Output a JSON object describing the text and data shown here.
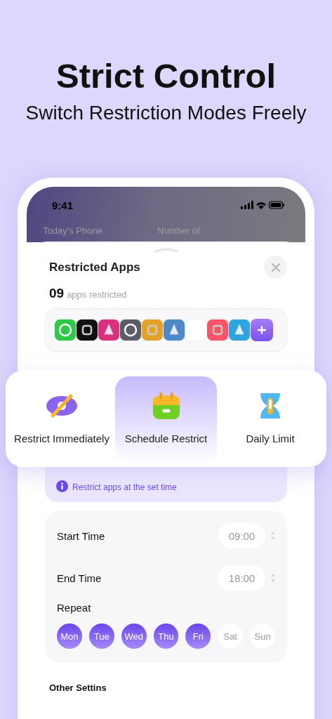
{
  "headline": {
    "title": "Strict Control",
    "subtitle": "Switch Restriction Modes Freely"
  },
  "status_bar": {
    "time": "9:41"
  },
  "background_stats": [
    "Today's Phone",
    "Number of"
  ],
  "sheet": {
    "title": "Restricted Apps",
    "count": "09",
    "count_label": "apps restricted",
    "apps": [
      {
        "color": "#2fc94a"
      },
      {
        "color": "#111111"
      },
      {
        "color": "#d9317e"
      },
      {
        "color": "#5a5d66"
      },
      {
        "color": "#e3a128"
      },
      {
        "color": "#4f88c9"
      },
      {
        "color": "#ffffff"
      },
      {
        "color": "#fe5468"
      },
      {
        "color": "#2ca5e0"
      }
    ],
    "modes": [
      {
        "label": "Restrict Immediately",
        "kind": "eye",
        "selected": false
      },
      {
        "label": "Schedule Restrict",
        "kind": "calendar",
        "selected": true
      },
      {
        "label": "Daily Limit",
        "kind": "hourglass",
        "selected": false
      }
    ],
    "info": "Restrict apps at the set time",
    "times": [
      {
        "label": "Start Time",
        "value": "09:00"
      },
      {
        "label": "End Time",
        "value": "18:00"
      }
    ],
    "repeat_label": "Repeat",
    "days": [
      {
        "label": "Mon",
        "selected": true
      },
      {
        "label": "Tue",
        "selected": true
      },
      {
        "label": "Wed",
        "selected": true
      },
      {
        "label": "Thu",
        "selected": true
      },
      {
        "label": "Fri",
        "selected": true
      },
      {
        "label": "Sat",
        "selected": false
      },
      {
        "label": "Sun",
        "selected": false
      }
    ],
    "other_heading": "Other Settins"
  }
}
